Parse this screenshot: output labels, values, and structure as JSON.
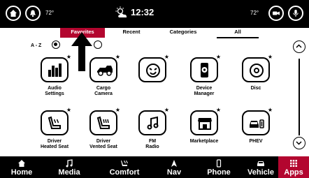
{
  "status_bar": {
    "left_temp": "72°",
    "clock": "12:32",
    "right_temp": "72°"
  },
  "tabs": [
    {
      "label": "Favorites",
      "active": true
    },
    {
      "label": "Recent",
      "active": false
    },
    {
      "label": "Categories",
      "active": false
    },
    {
      "label": "All",
      "active": false
    }
  ],
  "sort": {
    "az_label": "A - Z",
    "az_selected": true,
    "other_selected": false
  },
  "apps": [
    {
      "label_lines": [
        "Audio",
        "Settings"
      ],
      "icon": "equalizer-icon",
      "favorite": true
    },
    {
      "label_lines": [
        "Cargo",
        "Camera"
      ],
      "icon": "truck-camera-icon",
      "favorite": true
    },
    {
      "label_lines": [
        "",
        ""
      ],
      "icon": "smiley-icon",
      "favorite": true
    },
    {
      "label_lines": [
        "Device",
        "Manager"
      ],
      "icon": "phone-gear-icon",
      "favorite": true
    },
    {
      "label_lines": [
        "Disc",
        ""
      ],
      "icon": "disc-icon",
      "favorite": true
    },
    {
      "label_lines": [
        "Driver",
        "Heated Seat"
      ],
      "icon": "heated-seat-icon",
      "favorite": true
    },
    {
      "label_lines": [
        "Driver",
        "Vented Seat"
      ],
      "icon": "vented-seat-icon",
      "favorite": true
    },
    {
      "label_lines": [
        "FM",
        "Radio"
      ],
      "icon": "music-note-icon",
      "favorite": true
    },
    {
      "label_lines": [
        "Marketplace",
        ""
      ],
      "icon": "store-icon",
      "favorite": true
    },
    {
      "label_lines": [
        "PHEV",
        ""
      ],
      "icon": "car-plug-icon",
      "favorite": true
    }
  ],
  "bottom_nav": [
    {
      "label": "Home",
      "icon": "home-icon",
      "active": false
    },
    {
      "label": "Media",
      "icon": "music-note-icon",
      "active": false
    },
    {
      "label": "Comfort",
      "icon": "comfort-icon",
      "active": false
    },
    {
      "label": "Nav",
      "icon": "nav-arrow-icon",
      "active": false
    },
    {
      "label": "Phone",
      "icon": "phone-icon",
      "active": false
    },
    {
      "label": "Vehicle",
      "icon": "car-icon",
      "active": false
    },
    {
      "label": "Apps",
      "icon": "grid-icon",
      "active": true
    }
  ],
  "colors": {
    "accent": "#b3062f",
    "bar": "#000000",
    "background": "#ffffff"
  }
}
